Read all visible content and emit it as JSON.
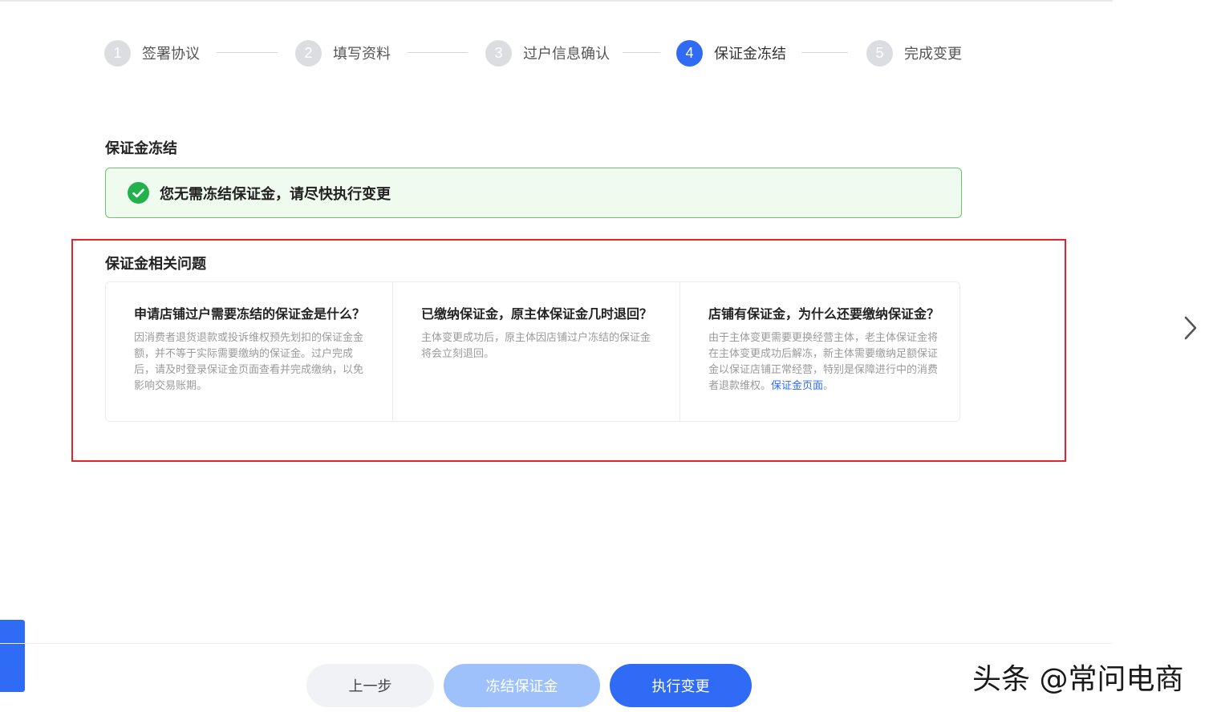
{
  "steps": [
    {
      "num": "1",
      "label": "签署协议"
    },
    {
      "num": "2",
      "label": "填写资料"
    },
    {
      "num": "3",
      "label": "过户信息确认"
    },
    {
      "num": "4",
      "label": "保证金冻结"
    },
    {
      "num": "5",
      "label": "完成变更"
    }
  ],
  "active_step": 4,
  "deposit_section": {
    "title": "保证金冻结",
    "success_message": "您无需冻结保证金，请尽快执行变更"
  },
  "faq_section": {
    "title": "保证金相关问题",
    "items": [
      {
        "question": "申请店铺过户需要冻结的保证金是什么？",
        "answer": "因消费者退货退款或投诉维权预先划扣的保证金金额，并不等于实际需要缴纳的保证金。过户完成后，请及时登录保证金页面查看并完成缴纳，以免影响交易账期。"
      },
      {
        "question": "已缴纳保证金，原主体保证金几时退回？",
        "answer": "主体变更成功后，原主体因店铺过户冻结的保证金将会立刻退回。"
      },
      {
        "question": "店铺有保证金，为什么还要缴纳保证金？",
        "answer": "由于主体变更需要更换经营主体，老主体保证金将在主体变更成功后解冻，新主体需要缴纳足额保证金以保证店铺正常经营，特别是保障进行中的消费者退款维权。",
        "link_text": "保证金页面",
        "answer_suffix": "。"
      }
    ]
  },
  "buttons": {
    "prev": "上一步",
    "freeze": "冻结保证金",
    "execute": "执行变更"
  },
  "watermark": "头条 @常问电商",
  "colors": {
    "primary": "#2f6bf5",
    "success": "#22b14c",
    "highlight_frame": "#e0252b"
  }
}
